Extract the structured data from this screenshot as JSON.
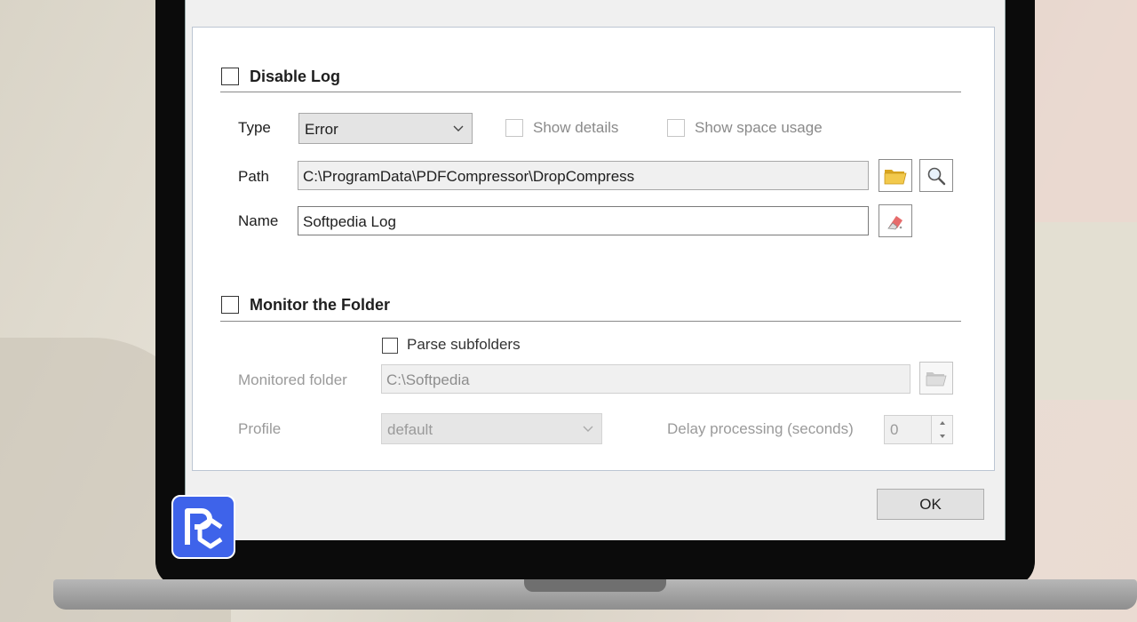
{
  "log_section": {
    "title": "Disable Log",
    "type_label": "Type",
    "type_value": "Error",
    "show_details_label": "Show details",
    "show_space_usage_label": "Show space usage",
    "path_label": "Path",
    "path_value": "C:\\ProgramData\\PDFCompressor\\DropCompress",
    "name_label": "Name",
    "name_value": "Softpedia Log"
  },
  "monitor_section": {
    "title": "Monitor the Folder",
    "parse_subfolders_label": "Parse subfolders",
    "monitored_folder_label": "Monitored folder",
    "monitored_folder_value": "C:\\Softpedia",
    "profile_label": "Profile",
    "profile_value": "default",
    "delay_label": "Delay processing (seconds)",
    "delay_value": "0"
  },
  "footer": {
    "ok_label": "OK"
  },
  "colors": {
    "logo_blue": "#3e63ea",
    "folder_yellow": "#f2c94c"
  },
  "icons": [
    "folder-icon",
    "search-icon",
    "eraser-icon",
    "chevron-down-icon",
    "spin-up-icon",
    "spin-down-icon",
    "app-logo"
  ]
}
